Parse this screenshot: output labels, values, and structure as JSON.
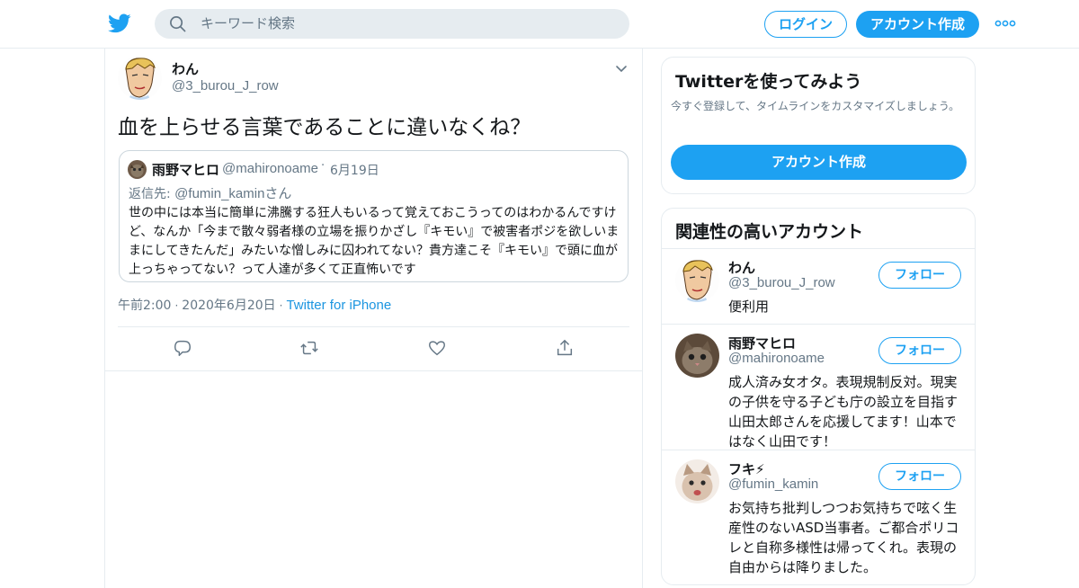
{
  "header": {
    "search_placeholder": "キーワード検索",
    "login_label": "ログイン",
    "signup_label": "アカウント作成",
    "brand_color": "#1da1f2",
    "icons": [
      "twitter-bird-icon",
      "search-icon",
      "more-dots-icon"
    ]
  },
  "tweet": {
    "name": "わん",
    "handle": "@3_burou_J_row",
    "text": "血を上らせる言葉であることに違いなくね？",
    "quote": {
      "name": "雨野マヒロ",
      "handle": "@mahironoame",
      "sep": "·",
      "date": "6月19日",
      "reply_label": "返信先: ",
      "reply_to": "@fumin_kaminさん",
      "body": "世の中には本当に簡単に沸騰する狂人もいるって覚えておこうってのはわかるんですけど、なんか「今まで散々弱者様の立場を振りかざし『キモい』で被害者ポジを欲しいままにしてきたんだ」みたいな憎しみに囚われてない？貴方達こそ『キモい』で頭に血が上っちゃってない？って人達が多くて正直怖いです"
    },
    "time": "午前2:00",
    "date": "2020年6月20日",
    "dot": "·",
    "source": "Twitter for iPhone",
    "actions": [
      "reply-icon",
      "retweet-icon",
      "like-icon",
      "share-icon"
    ]
  },
  "signup_card": {
    "title": "Twitterを使ってみよう",
    "subtitle": "今すぐ登録して、タイムラインをカスタマイズしましょう。",
    "button": "アカウント作成"
  },
  "related": {
    "title": "関連性の高いアカウント",
    "follow_label": "フォロー",
    "accounts": [
      {
        "name": "わん",
        "handle": "@3_burou_J_row",
        "bio": "便利用"
      },
      {
        "name": "雨野マヒロ",
        "handle": "@mahironoame",
        "bio": "成人済み女オタ。表現規制反対。現実の子供を守る子ども庁の設立を目指す山田太郎さんを応援してます！山本ではなく山田です！"
      },
      {
        "name": "フキ⚡",
        "handle": "@fumin_kamin",
        "bio": "お気持ち批判しつつお気持ちで呟く生産性のないASD当事者。ご都合ポリコレと自称多様性は帰ってくれ。表現の自由からは降りました。"
      }
    ]
  }
}
